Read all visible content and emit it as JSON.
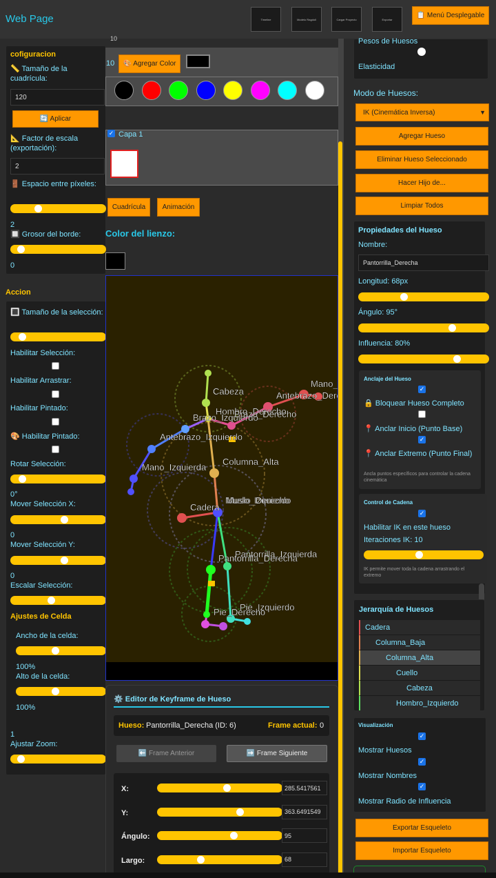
{
  "header": {
    "brand": "Web Page",
    "buttons": [
      "Timeline",
      "Modelo Ragdoll",
      "Cargar Proyecto",
      "Exportar"
    ],
    "menu": "📋 Menú Desplegable"
  },
  "left": {
    "config": {
      "title": "cofiguracion",
      "grid_label": "📏 Tamaño de la cuadrícula:",
      "grid_value": "120",
      "apply": "🔄 Aplicar",
      "scale_label": "📐 Factor de escala (exportación):",
      "scale_value": "2",
      "spacing_label": "🚪 Espacio entre píxeles:",
      "spacing_value": "2",
      "spacing_level": 0.27,
      "border_label": "🔲 Grosor del borde:",
      "border_value": "0",
      "border_level": 0.08
    },
    "accion": {
      "title": "Accion",
      "selsize_label": "🔳 Tamaño de la selección:",
      "selsize_level": 0.09,
      "enable_selection": "Habilitar Selección:",
      "enable_drag": "Habilitar Arrastrar:",
      "enable_paint": "Habilitar Pintado:",
      "enable_paint2": "🎨 Habilitar Pintado:",
      "rotate_label": "Rotar Selección:",
      "rotate_value": "0°",
      "rotate_level": 0.09,
      "movex_label": "Mover Selección X:",
      "movex_value": "0",
      "movex_level": 0.57,
      "movey_label": "Mover Selección Y:",
      "movey_value": "0",
      "movey_level": 0.57,
      "scale_label": "Escalar Selección:",
      "scale_level": 0.42
    },
    "cell": {
      "title": "Ajustes de Celda",
      "width_label": "Ancho de la celda:",
      "width_value": "100%",
      "width_level": 0.43,
      "height_label": "Alto de la celda:",
      "height_value": "100%",
      "height_level": 0.43,
      "zoom_value": "1",
      "zoom_label": "Ajustar Zoom:",
      "zoom_level": 0.08
    }
  },
  "center": {
    "top_value": "10",
    "color_row_value": "10",
    "add_color": "🎨 Agregar Color",
    "swatches": [
      "#000000",
      "#ff0000",
      "#00ff00",
      "#0000ff",
      "#ffff00",
      "#ff00ff",
      "#00ffff",
      "#ffffff"
    ],
    "layer": "Capa 1",
    "tab_grid": "Cuadrícula",
    "tab_anim": "Animación",
    "canvas_color_label": "Color del lienzo:",
    "keyframe": {
      "title": "⚙️ Editor de Keyframe de Hueso",
      "bone_label": "Hueso:",
      "bone_value": "Pantorrilla_Derecha (ID: 6)",
      "frame_label": "Frame actual:",
      "frame_value": "0",
      "prev": "⬅️ Frame Anterior",
      "next": "➡️ Frame Siguiente",
      "fields": [
        {
          "label": "X:",
          "value": "285.5417561",
          "level": 0.56
        },
        {
          "label": "Y:",
          "value": "363.6491549",
          "level": 0.67
        },
        {
          "label": "Ángulo:",
          "value": "95",
          "level": 0.62
        },
        {
          "label": "Largo:",
          "value": "68",
          "level": 0.34
        }
      ]
    }
  },
  "skeleton": {
    "labels": [
      "Cabeza",
      "Hombro_Derecho",
      "Brazo_Izquierdo",
      "Brazo_Derecho",
      "Antebrazo_Derecho",
      "Mano_Derecha",
      "Antebrazo_Izquierdo",
      "Mano_Izquierda",
      "Columna_Alta",
      "Cadera",
      "Muslo_Izquierdo",
      "Muslo_Derecho",
      "Pantorrilla_Izquierda",
      "Pantorrilla_Derecha",
      "Pie_Izquierdo",
      "Pie_Derecho"
    ]
  },
  "right": {
    "pesos_label": "Pesos de Huesos",
    "elasticity": "Elasticidad",
    "mode_label": "Modo de Huesos:",
    "mode_value": "IK (Cinemática Inversa)",
    "buttons": [
      "Agregar Hueso",
      "Eliminar Hueso Seleccionado",
      "Hacer Hijo de...",
      "Limpiar Todos"
    ],
    "props": {
      "title": "Propiedades del Hueso",
      "name_label": "Nombre:",
      "name_value": "Pantorrilla_Derecha",
      "length_label": "Longitud: 68px",
      "length_level": 0.34,
      "angle_label": "Ángulo: 95°",
      "angle_level": 0.73,
      "influence_label": "Influencia: 80%",
      "influence_level": 0.77
    },
    "anchor": {
      "title": "Anclaje del Hueso",
      "lock": "🔒 Bloquear Hueso Completo",
      "start": "📍 Anclar Inicio (Punto Base)",
      "end": "📍 Anclar Extremo (Punto Final)",
      "note": "Ancla puntos específicos para controlar la cadena cinemática"
    },
    "chain": {
      "title": "Control de Cadena",
      "enable": "Habilitar IK en este hueso",
      "iter": "Iteraciones IK: 10",
      "iter_level": 0.46,
      "note": "IK permite mover toda la cadena arrastrando el extremo"
    },
    "hierarchy": {
      "title": "Jerarquía de Huesos",
      "items": [
        {
          "name": "Cadera",
          "color": "#e05050",
          "indent": 0
        },
        {
          "name": "Columna_Baja",
          "color": "#e08050",
          "indent": 1
        },
        {
          "name": "Columna_Alta",
          "color": "#e0b050",
          "indent": 2
        },
        {
          "name": "Cuello",
          "color": "#e0e050",
          "indent": 3
        },
        {
          "name": "Cabeza",
          "color": "#b0e050",
          "indent": 4
        },
        {
          "name": "Hombro_Izquierdo",
          "color": "#60e060",
          "indent": 3
        }
      ]
    },
    "vis": {
      "title": "Visualización",
      "bones": "Mostrar Huesos",
      "names": "Mostrar Nombres",
      "radius": "Mostrar Radio de Influencia"
    },
    "export": "Exportar Esqueleto",
    "import": "Importar Esqueleto"
  }
}
